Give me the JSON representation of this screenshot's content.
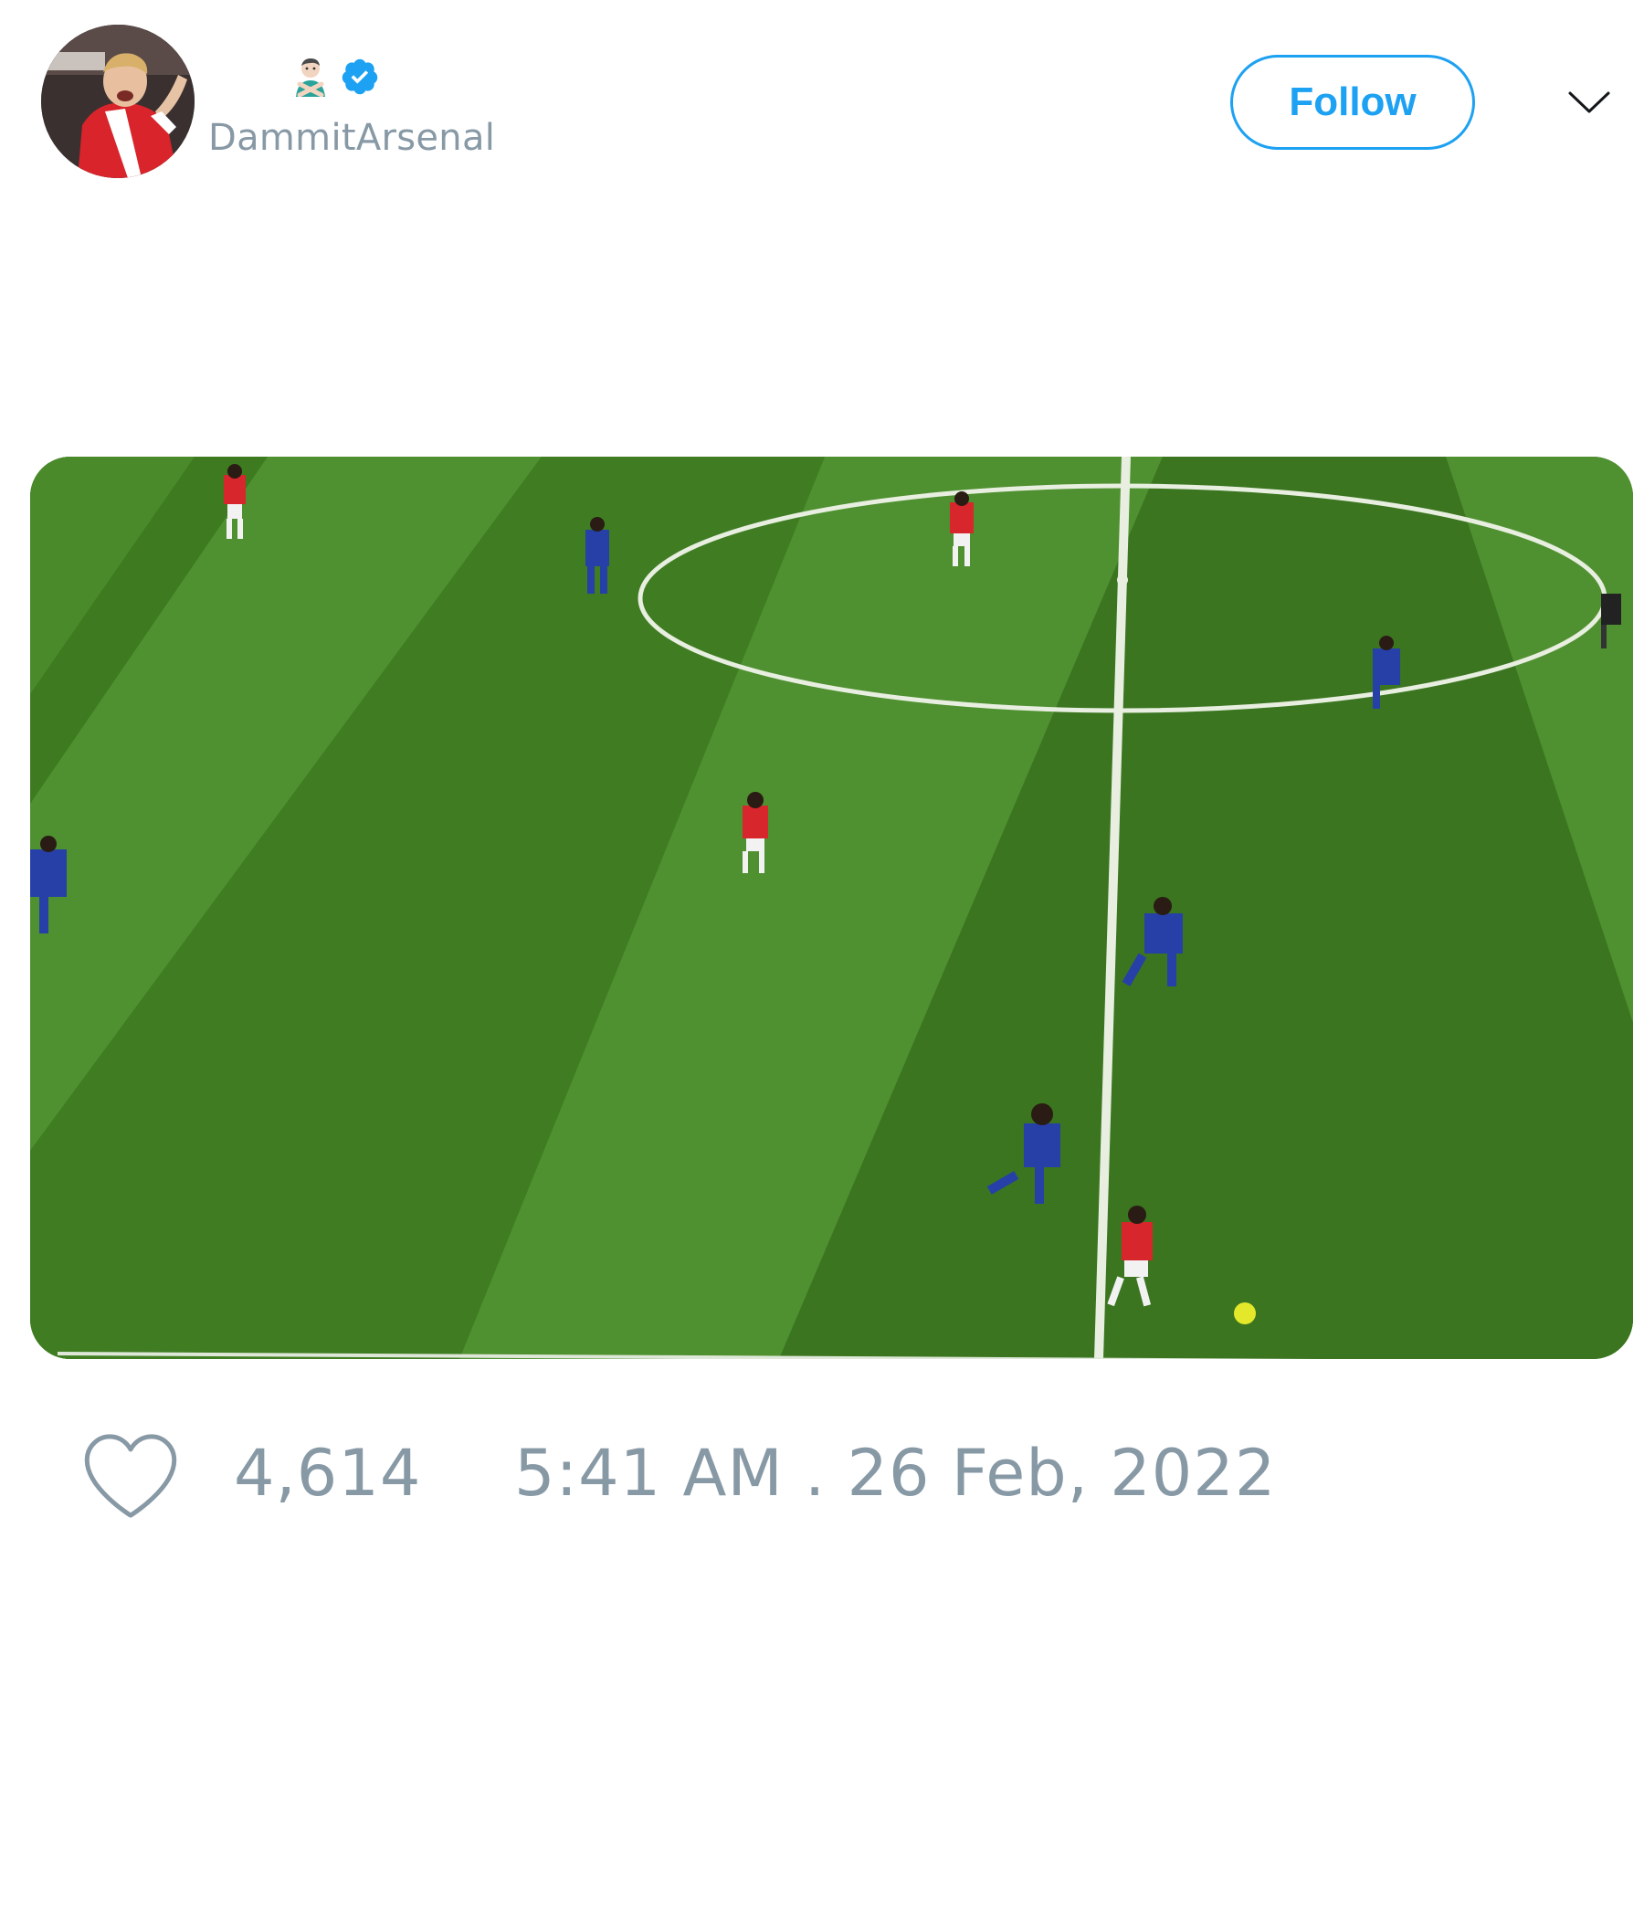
{
  "tweet": {
    "author": {
      "display_name_emoji": "🙅🏻‍♂️",
      "verified": true,
      "handle": "DammitArsenal",
      "avatar_icon": "player-photo-avatar"
    },
    "follow_label": "Follow",
    "more_icon": "chevron-down-icon",
    "media": {
      "kind": "video-still",
      "description_icon": "football-pitch-video"
    },
    "like_count": "4,614",
    "timestamp": "5:41 AM . 26 Feb, 2022"
  },
  "colors": {
    "accent": "#1da1f2",
    "muted_text": "#8899a6",
    "pitch_dark": "#3a7520",
    "pitch_light": "#4f9030"
  }
}
